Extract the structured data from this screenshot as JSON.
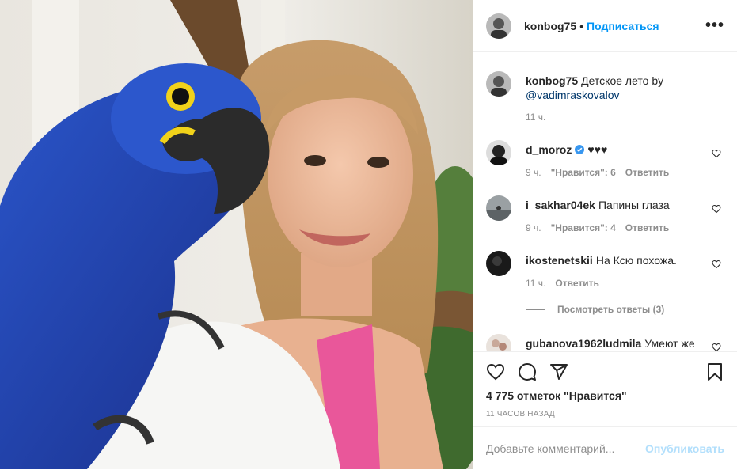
{
  "header": {
    "username": "konbog75",
    "dot": "•",
    "follow_label": "Подписаться",
    "more_icon": "more-options-icon"
  },
  "caption": {
    "username": "konbog75",
    "text": "Детское лето by",
    "mention": "@vadimraskovalov",
    "time": "11 ч."
  },
  "comments": [
    {
      "username": "d_moroz",
      "verified": true,
      "text": "♥♥♥",
      "time": "9 ч.",
      "likes": "\"Нравится\": 6",
      "reply": "Ответить"
    },
    {
      "username": "i_sakhar04ek",
      "text": "Папины глаза",
      "time": "9 ч.",
      "likes": "\"Нравится\": 4",
      "reply": "Ответить"
    },
    {
      "username": "ikostenetskii",
      "text": "На Ксю похожа.",
      "time": "11 ч.",
      "reply": "Ответить"
    },
    {
      "username": "gubanova1962ludmila",
      "text": "Умеют же"
    }
  ],
  "view_replies": "Посмотреть ответы (3)",
  "likes_count": "4 775 отметок \"Нравится\"",
  "post_time": "11 ЧАСОВ НАЗАД",
  "add_comment": {
    "placeholder": "Добавьте комментарий...",
    "post_label": "Опубликовать"
  },
  "colors": {
    "accent": "#0095f6",
    "post_disabled": "#b2dffc",
    "muted": "#8e8e8e",
    "verified": "#3897f0"
  }
}
